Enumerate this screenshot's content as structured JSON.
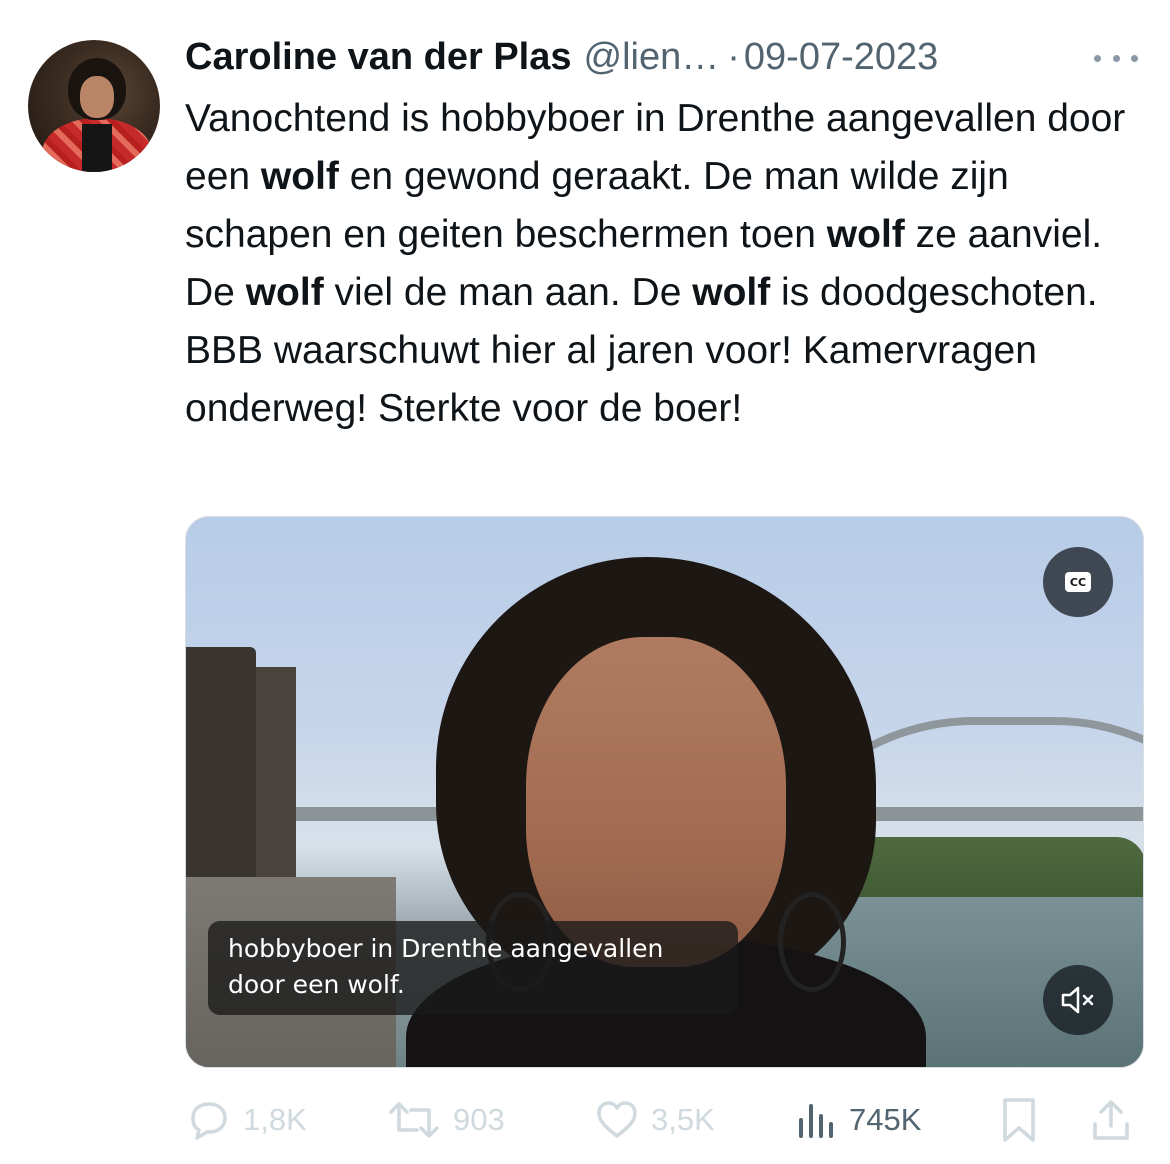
{
  "tweet": {
    "author_name": "Caroline van der Plas",
    "author_handle": "@lien…",
    "separator": "·",
    "date": "09-07-2023",
    "text_segments": [
      {
        "text": "Vanochtend is hobbyboer in Drenthe aangevallen door een ",
        "bold": false
      },
      {
        "text": "wolf",
        "bold": true
      },
      {
        "text": " en gewond geraakt. De man wilde zijn schapen en geiten beschermen toen ",
        "bold": false
      },
      {
        "text": "wolf",
        "bold": true
      },
      {
        "text": " ze aanviel. De ",
        "bold": false
      },
      {
        "text": "wolf",
        "bold": true
      },
      {
        "text": " viel de man aan. De ",
        "bold": false
      },
      {
        "text": "wolf",
        "bold": true
      },
      {
        "text": " is doodgeschoten.  BBB waarschuwt hier al jaren voor! Kamervragen onderweg! Sterkte voor de boer!",
        "bold": false
      }
    ]
  },
  "media": {
    "cc_label": "CC",
    "caption_line1": "hobbyboer in Drenthe aangevallen",
    "caption_line2": "door een wolf."
  },
  "actions": {
    "replies": "1,8K",
    "reposts": "903",
    "likes": "3,5K",
    "views": "745K"
  },
  "icons": [
    "more-icon",
    "cc-icon",
    "mute-icon",
    "reply-icon",
    "repost-icon",
    "like-icon",
    "views-icon",
    "bookmark-icon",
    "share-icon"
  ],
  "colors": {
    "text": "#0f1419",
    "secondary": "#536471",
    "muted_action": "#cfd9de"
  }
}
